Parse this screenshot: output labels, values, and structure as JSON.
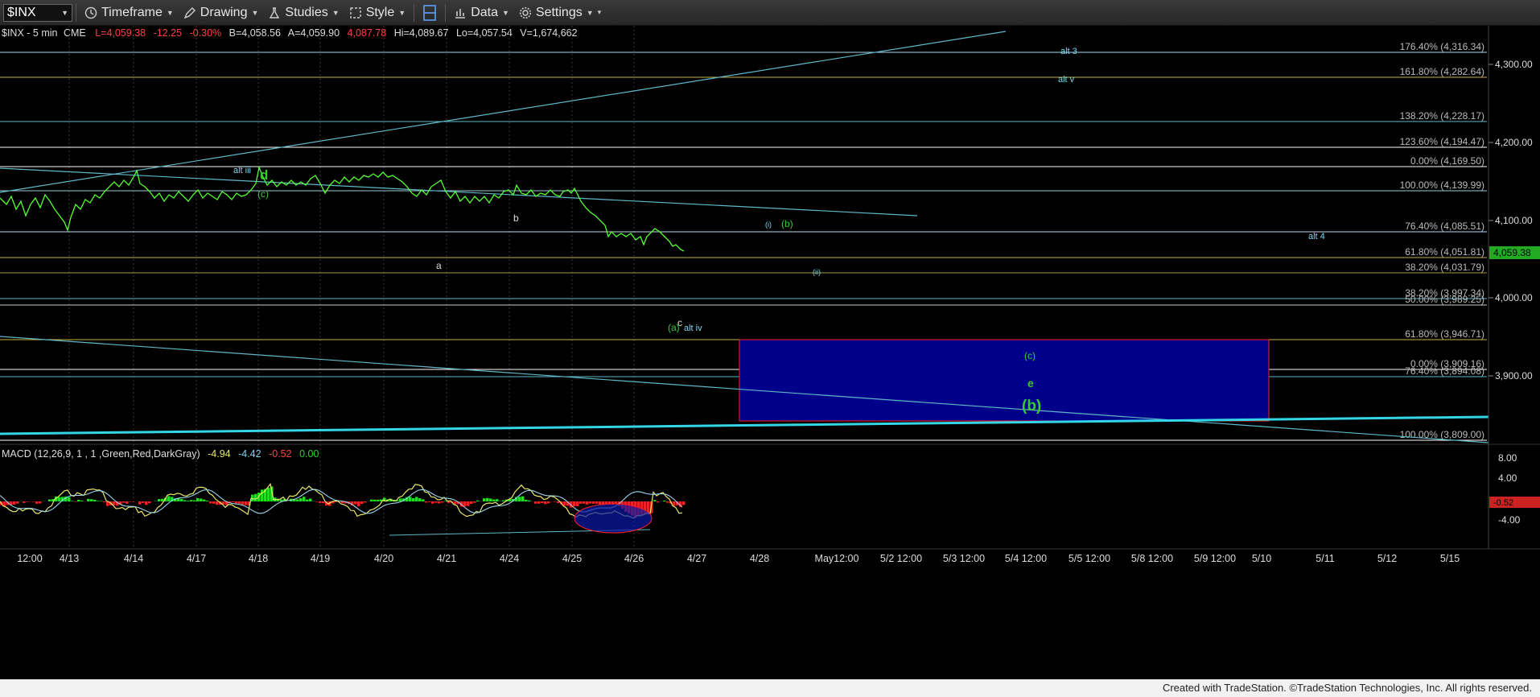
{
  "toolbar": {
    "symbol": "$INX",
    "timeframe": "Timeframe",
    "drawing": "Drawing",
    "studies": "Studies",
    "style": "Style",
    "data": "Data",
    "settings": "Settings"
  },
  "header": {
    "symbol": "$INX - 5 min",
    "exchange": "CME",
    "last": "L=4,059.38",
    "change": "-12.25",
    "change_pct": "-0.30%",
    "bid": "B=4,058.56",
    "ask": "A=4,059.90",
    "open": "4,087.78",
    "high": "Hi=4,089.67",
    "low": "Lo=4,057.54",
    "volume": "V=1,674,662"
  },
  "price_axis": {
    "ticks": [
      "4,300.00",
      "4,200.00",
      "4,100.00",
      "4,000.00",
      "3,900.00"
    ],
    "last_price": "4,059.38"
  },
  "fib_levels": [
    {
      "label": "176.40% (4,316.34)",
      "color": "#aad8ee"
    },
    {
      "label": "161.80% (4,282.64)",
      "color": "#c9b23a"
    },
    {
      "label": "138.20% (4,228.17)",
      "color": "#5fb8c8"
    },
    {
      "label": "123.60% (4,194.47)",
      "color": "#ffffff"
    },
    {
      "label": "0.00% (4,169.50)",
      "color": "#ffffff"
    },
    {
      "label": "100.00% (4,139.99)",
      "color": "#9fc7d9"
    },
    {
      "label": "76.40% (4,085.51)",
      "color": "#b9d6e6"
    },
    {
      "label": "61.80% (4,051.81)",
      "color": "#c9b23a"
    },
    {
      "label": "38.20% (4,031.79)",
      "color": "#a6983a"
    },
    {
      "label": "38.20% (3,997.34)",
      "color": "#5fb8c8"
    },
    {
      "label": "50.00% (3,989.25)",
      "color": "#cccccc"
    },
    {
      "label": "61.80% (3,946.71)",
      "color": "#c9b23a"
    },
    {
      "label": "0.00% (3,909.16)",
      "color": "#ffffff"
    },
    {
      "label": "76.40% (3,894.08)",
      "color": "#5fb8c8"
    },
    {
      "label": "100.00% (3,809.00)",
      "color": "#ffffff"
    }
  ],
  "wave_labels": {
    "alt3": "alt 3",
    "altv": "alt v",
    "altiii": "alt iii",
    "d": "d",
    "c_paren": "(c)",
    "b": "b",
    "a": "a",
    "i_small": "(i)",
    "b_paren": "(b)",
    "ii_small": "(ii)",
    "alt4": "alt 4",
    "c": "c",
    "a_paren": "(a)",
    "altiv": "alt iv",
    "box_c": "(c)",
    "box_e": "e",
    "box_b": "(b)"
  },
  "macd": {
    "title": "MACD (12,26,9, 1 , 1 ,Green,Red,DarkGray)",
    "macd_value": "-4.94",
    "signal_value": "-4.42",
    "hist_value": "-0.52",
    "zero_value": "0.00",
    "axis": [
      "8.00",
      "4.00",
      "-4.00"
    ],
    "current": "-0.52"
  },
  "time_axis": [
    "12:00",
    "4/13",
    "4/14",
    "4/17",
    "4/18",
    "4/19",
    "4/20",
    "4/21",
    "4/24",
    "4/25",
    "4/26",
    "4/27",
    "4/28",
    "May12:00",
    "5/2 12:00",
    "5/3 12:00",
    "5/4 12:00",
    "5/5 12:00",
    "5/8 12:00",
    "5/9 12:00",
    "5/10",
    "5/11",
    "5/12",
    "5/15"
  ],
  "footer": "Created with TradeStation. ©TradeStation Technologies, Inc. All rights reserved.",
  "colors": {
    "price": "#55ff33",
    "trendline": "#5fb8c8",
    "target_box": "#00008b",
    "target_border": "#ff2020"
  }
}
